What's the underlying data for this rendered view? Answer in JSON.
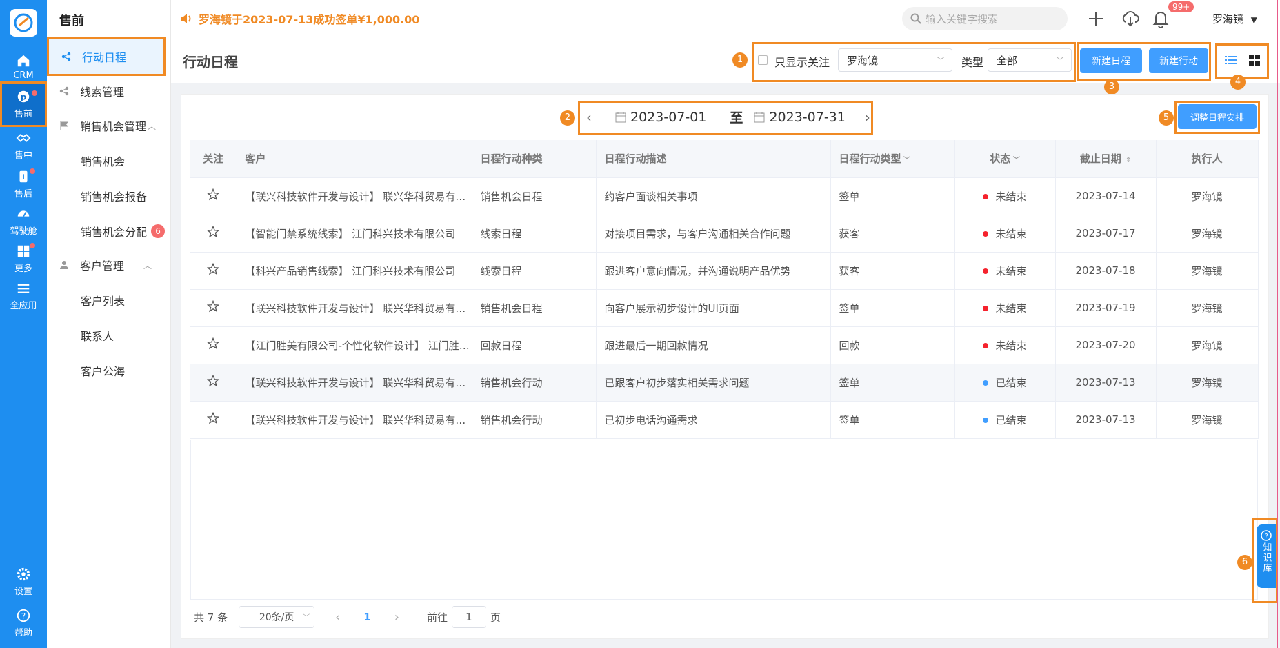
{
  "rail": {
    "items": [
      {
        "label": "CRM",
        "icon": "home-icon"
      },
      {
        "label": "售前",
        "icon": "pinterest-icon"
      },
      {
        "label": "售中",
        "icon": "handshake-icon"
      },
      {
        "label": "售后",
        "icon": "info-icon"
      },
      {
        "label": "驾驶舱",
        "icon": "dashboard-icon"
      },
      {
        "label": "更多",
        "icon": "grid-icon"
      },
      {
        "label": "全应用",
        "icon": "menu-icon"
      },
      {
        "label": "设置",
        "icon": "gear-icon"
      },
      {
        "label": "帮助",
        "icon": "help-icon"
      }
    ]
  },
  "sub": {
    "title": "售前",
    "items": [
      {
        "label": "行动日程"
      },
      {
        "label": "线索管理"
      },
      {
        "label": "销售机会管理"
      },
      {
        "label": "销售机会"
      },
      {
        "label": "销售机会报备"
      },
      {
        "label": "销售机会分配",
        "badge": "6"
      },
      {
        "label": "客户管理"
      },
      {
        "label": "客户列表"
      },
      {
        "label": "联系人"
      },
      {
        "label": "客户公海"
      }
    ]
  },
  "topbar": {
    "notice": "罗海镜于2023-07-13成功签单¥1,000.00",
    "search_placeholder": "输入关键字搜索",
    "bell_badge": "99+",
    "user": "罗海镜"
  },
  "head": {
    "title": "行动日程",
    "only_follow": "只显示关注",
    "person": "罗海镜",
    "type_label": "类型",
    "type_value": "全部",
    "new_schedule": "新建日程",
    "new_action": "新建行动",
    "adjust": "调整日程安排"
  },
  "callouts": [
    "1",
    "2",
    "3",
    "4",
    "5",
    "6"
  ],
  "date_range": {
    "start": "2023-07-01",
    "sep": "至",
    "end": "2023-07-31"
  },
  "table": {
    "headers": [
      "关注",
      "客户",
      "日程行动种类",
      "日程行动描述",
      "日程行动类型",
      "状态",
      "截止日期",
      "执行人"
    ],
    "rows": [
      [
        "【联兴科技软件开发与设计】 联兴华科贸易有限公司",
        "销售机会日程",
        "约客户面谈相关事项",
        "签单",
        "未结束",
        "2023-07-14",
        "罗海镜"
      ],
      [
        "【智能门禁系统线索】 江门科兴技术有限公司",
        "线索日程",
        "对接项目需求，与客户沟通相关合作问题",
        "获客",
        "未结束",
        "2023-07-17",
        "罗海镜"
      ],
      [
        "【科兴产品销售线索】 江门科兴技术有限公司",
        "线索日程",
        "跟进客户意向情况，并沟通说明产品优势",
        "获客",
        "未结束",
        "2023-07-18",
        "罗海镜"
      ],
      [
        "【联兴科技软件开发与设计】 联兴华科贸易有限公司",
        "销售机会日程",
        "向客户展示初步设计的UI页面",
        "签单",
        "未结束",
        "2023-07-19",
        "罗海镜"
      ],
      [
        "【江门胜美有限公司-个性化软件设计】 江门胜美有限公司",
        "回款日程",
        "跟进最后一期回款情况",
        "回款",
        "未结束",
        "2023-07-20",
        "罗海镜"
      ],
      [
        "【联兴科技软件开发与设计】 联兴华科贸易有限公司",
        "销售机会行动",
        "已跟客户初步落实相关需求问题",
        "签单",
        "已结束",
        "2023-07-13",
        "罗海镜"
      ],
      [
        "【联兴科技软件开发与设计】 联兴华科贸易有限公司",
        "销售机会行动",
        "已初步电话沟通需求",
        "签单",
        "已结束",
        "2023-07-13",
        "罗海镜"
      ]
    ],
    "status_colors": {
      "未结束": "#f5222d",
      "已结束": "#409eff"
    }
  },
  "pager": {
    "total": "共 7 条",
    "size": "20条/页",
    "page": "1",
    "goto": "前往",
    "goto_value": "1",
    "page_unit": "页"
  },
  "side_tab": {
    "label": "知识库"
  }
}
